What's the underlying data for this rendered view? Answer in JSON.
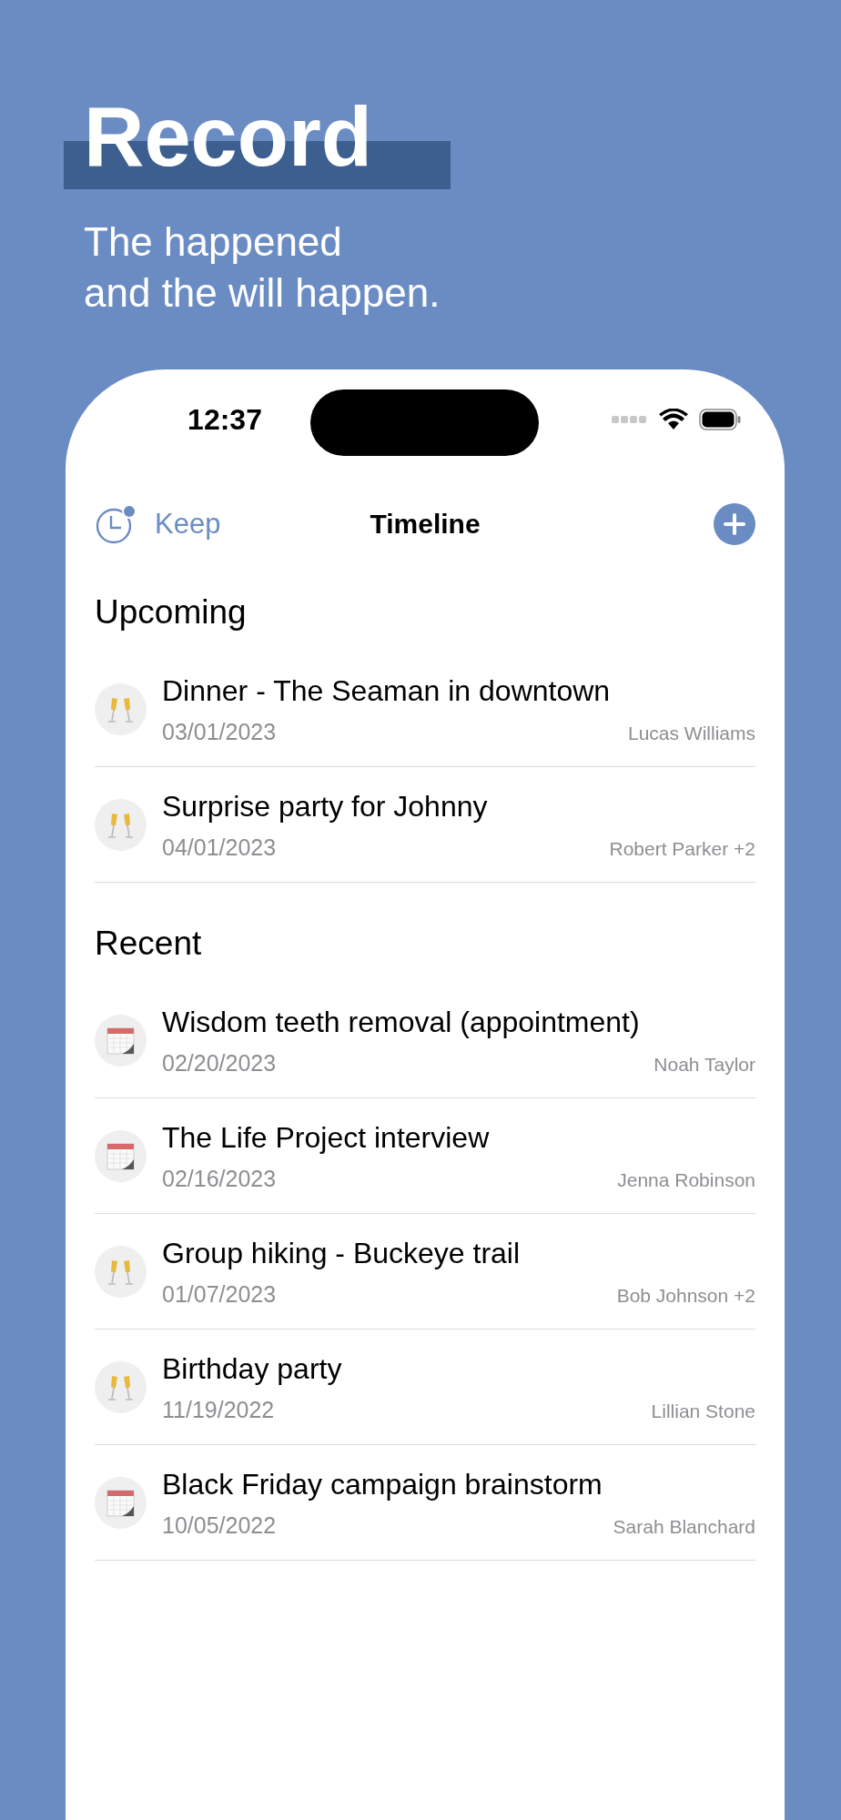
{
  "headline": {
    "title": "Record",
    "subtitle_lines": [
      "The happened",
      "and the will happen."
    ]
  },
  "status_bar": {
    "time": "12:37"
  },
  "nav": {
    "back_label": "Keep",
    "title": "Timeline",
    "has_badge": true
  },
  "sections": [
    {
      "title": "Upcoming",
      "items": [
        {
          "kind": "celebration",
          "title": "Dinner - The Seaman in downtown",
          "date": "03/01/2023",
          "people": "Lucas Williams"
        },
        {
          "kind": "celebration",
          "title": "Surprise party for Johnny",
          "date": "04/01/2023",
          "people": "Robert Parker +2"
        }
      ]
    },
    {
      "title": "Recent",
      "items": [
        {
          "kind": "calendar",
          "title": "Wisdom teeth removal (appointment)",
          "date": "02/20/2023",
          "people": "Noah Taylor"
        },
        {
          "kind": "calendar",
          "title": "The Life Project interview",
          "date": "02/16/2023",
          "people": "Jenna Robinson"
        },
        {
          "kind": "celebration",
          "title": "Group hiking - Buckeye trail",
          "date": "01/07/2023",
          "people": "Bob Johnson +2"
        },
        {
          "kind": "celebration",
          "title": "Birthday party",
          "date": "11/19/2022",
          "people": "Lillian Stone"
        },
        {
          "kind": "calendar",
          "title": "Black Friday campaign brainstorm",
          "date": "10/05/2022",
          "people": "Sarah Blanchard"
        }
      ]
    }
  ]
}
